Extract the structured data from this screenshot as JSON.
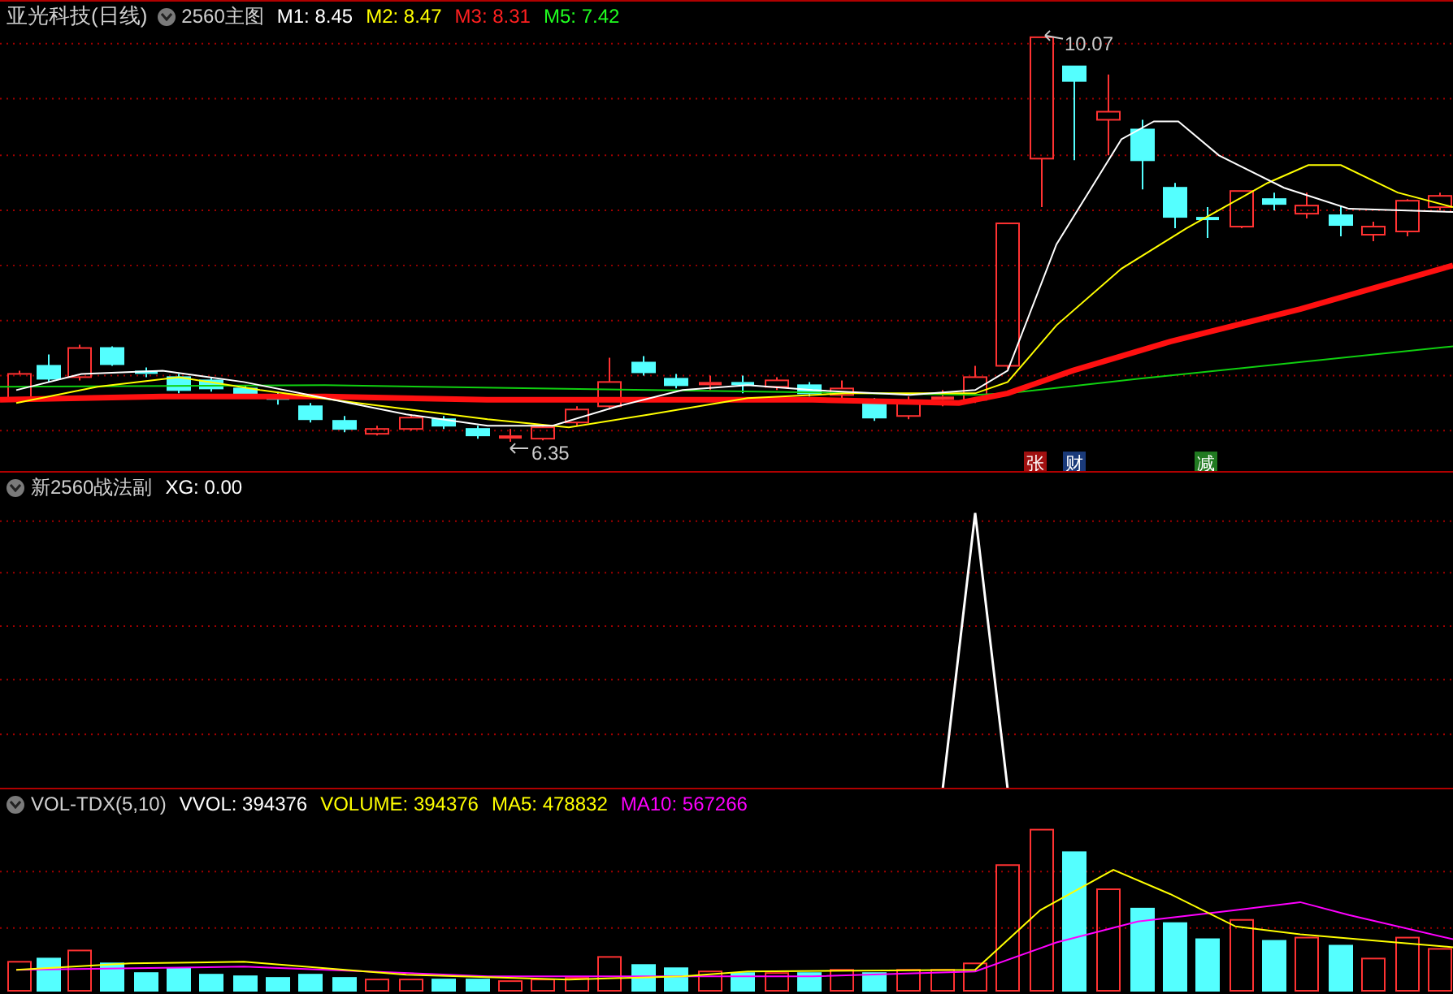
{
  "window": {
    "title": "亚光科技(日线)"
  },
  "main_panel": {
    "indicator": "2560主图",
    "readings": [
      {
        "label": "M1: 8.45",
        "color": "#ffffff"
      },
      {
        "label": "M2: 8.47",
        "color": "#ffff00"
      },
      {
        "label": "M3: 8.31",
        "color": "#ff2020"
      },
      {
        "label": "M5: 7.42",
        "color": "#20ff20"
      }
    ],
    "annotations": [
      {
        "text": "10.07"
      },
      {
        "text": "6.35"
      }
    ],
    "signals": [
      {
        "text": "张",
        "color": "#a01010"
      },
      {
        "text": "财",
        "color": "#1a3a7a"
      },
      {
        "text": "减",
        "color": "#207a20"
      }
    ]
  },
  "sub_panel": {
    "indicator": "新2560战法副",
    "readings": [
      {
        "label": "XG: 0.00",
        "color": "#ffffff"
      }
    ]
  },
  "volume_panel": {
    "indicator": "VOL-TDX(5,10)",
    "readings": [
      {
        "label": "VVOL: 394376",
        "color": "#ffffff"
      },
      {
        "label": "VOLUME: 394376",
        "color": "#ffff00"
      },
      {
        "label": "MA5: 478832",
        "color": "#ffff00"
      },
      {
        "label": "MA10: 567266",
        "color": "#ff00ff"
      }
    ]
  }
}
